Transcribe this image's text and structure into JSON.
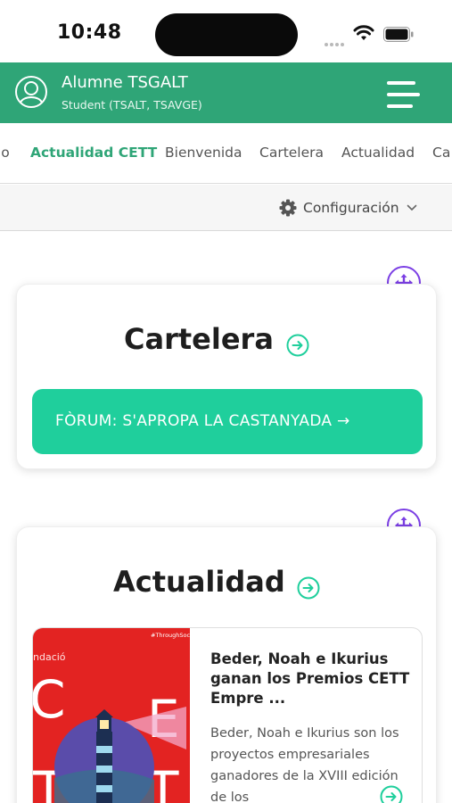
{
  "status_bar": {
    "time": "10:48"
  },
  "header": {
    "user_name": "Alumne TSGALT",
    "user_role": "Student (TSALT, TSAVGE)",
    "avatar_icon": "user-circle-icon",
    "menu_icon": "hamburger-menu-icon"
  },
  "tabs": [
    {
      "label": "io",
      "active": false
    },
    {
      "label": "Actualidad CETT",
      "active": true
    },
    {
      "label": "Bienvenida",
      "active": false
    },
    {
      "label": "Cartelera",
      "active": false
    },
    {
      "label": "Actualidad",
      "active": false
    },
    {
      "label": "Ca",
      "active": false
    }
  ],
  "config": {
    "label": "Configuración",
    "icon": "gear-icon"
  },
  "cartelera": {
    "title": "Cartelera",
    "cta_label": "FÒRUM: S'APROPA LA CASTANYADA →"
  },
  "actualidad": {
    "title": "Actualidad",
    "news": {
      "image_hashtag": "#ThroughSoc",
      "image_brand": "ndació",
      "image_letters": [
        "C",
        "E",
        "T",
        "T"
      ],
      "title": "Beder, Noah e Ikurius ganan los Premios CETT Empre ...",
      "description": "Beder, Noah e Ikurius son los proyectos empresariales ganadores de la XVIII edición de los"
    }
  },
  "colors": {
    "brand_green": "#2fa577",
    "cta_teal": "#1fcf9c",
    "move_purple": "#7b3fe4",
    "news_red": "#e32322"
  }
}
